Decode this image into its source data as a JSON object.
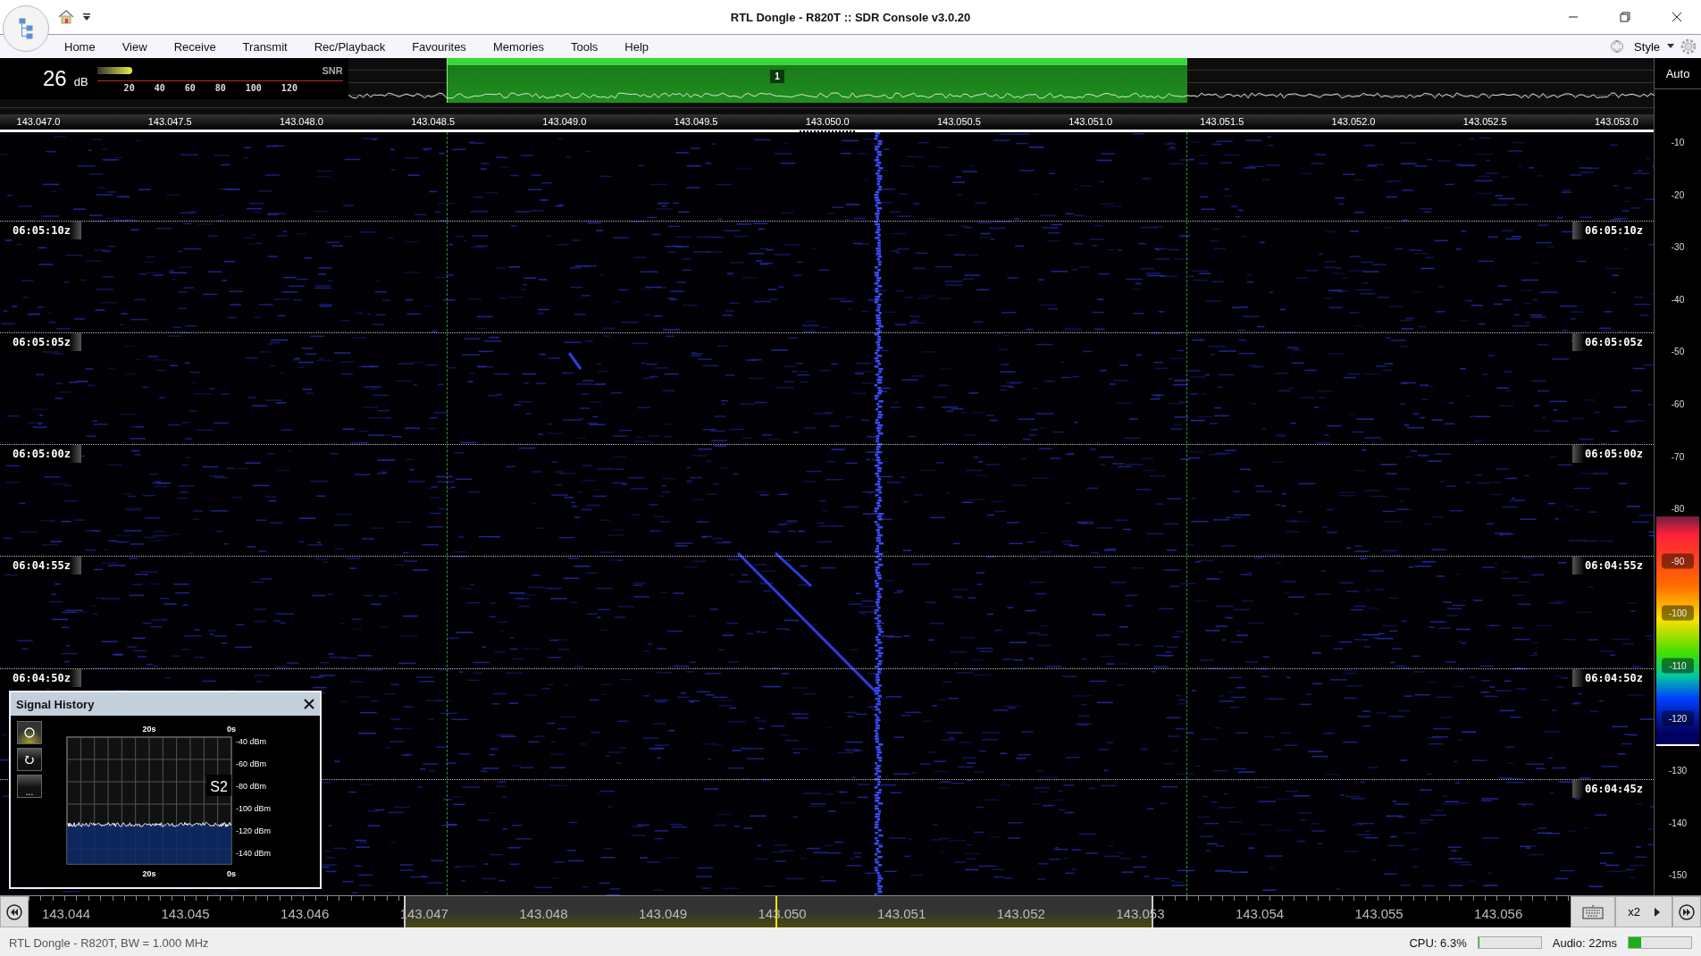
{
  "window": {
    "title": "RTL Dongle - R820T :: SDR Console v3.0.20"
  },
  "menu": [
    "Home",
    "View",
    "Receive",
    "Transmit",
    "Rec/Playback",
    "Favourites",
    "Memories",
    "Tools",
    "Help"
  ],
  "style_menu": {
    "label": "Style"
  },
  "snr_meter": {
    "value": "26",
    "unit": "dB",
    "label": "SNR",
    "level": 0.3,
    "scale": [
      "20",
      "40",
      "60",
      "80",
      "100",
      "120"
    ]
  },
  "spectrum": {
    "receiver_marker": "1",
    "frequency_labels": [
      "143.047.0",
      "143.047.5",
      "143.048.0",
      "143.048.5",
      "143.049.0",
      "143.049.5",
      "143.050.0",
      "143.050.5",
      "143.051.0",
      "143.051.5",
      "143.052.0",
      "143.052.5",
      "143.053.0"
    ]
  },
  "level_scale": {
    "auto_button": "Auto",
    "labels": [
      {
        "text": "-10",
        "kind": "plain"
      },
      {
        "text": "-20",
        "kind": "plain"
      },
      {
        "text": "-30",
        "kind": "plain"
      },
      {
        "text": "-40",
        "kind": "plain"
      },
      {
        "text": "-50",
        "kind": "plain"
      },
      {
        "text": "-60",
        "kind": "plain"
      },
      {
        "text": "-70",
        "kind": "plain"
      },
      {
        "text": "-80",
        "kind": "plain"
      },
      {
        "text": "-90",
        "kind": "marker"
      },
      {
        "text": "-100",
        "kind": "marker"
      },
      {
        "text": "-110",
        "kind": "marker"
      },
      {
        "text": "-120",
        "kind": "marker"
      },
      {
        "text": "-130",
        "kind": "plain"
      },
      {
        "text": "-140",
        "kind": "plain"
      },
      {
        "text": "-150",
        "kind": "plain"
      }
    ]
  },
  "waterfall": {
    "left_time_labels": [
      "06:05:10z",
      "06:05:05z",
      "06:05:00z",
      "06:04:55z",
      "06:04:50z"
    ],
    "right_time_labels": [
      "06:05:10z",
      "06:05:05z",
      "06:05:00z",
      "06:04:55z",
      "06:04:50z",
      "06:04:45z"
    ]
  },
  "signal_history": {
    "title": "Signal History",
    "more_button": "...",
    "top_time_labels": [
      "20s",
      "0s"
    ],
    "bottom_time_labels": [
      "20s",
      "0s"
    ],
    "level_labels": [
      "-40 dBm",
      "-60 dBm",
      "-80 dBm",
      "-100 dBm",
      "-120 dBm",
      "-140 dBm"
    ],
    "s_meter": "S2"
  },
  "tuning_bar": {
    "frequency_labels": [
      "143.044",
      "143.045",
      "143.046",
      "143.047",
      "143.048",
      "143.049",
      "143.050",
      "143.051",
      "143.052",
      "143.053",
      "143.054",
      "143.055",
      "143.056"
    ],
    "zoom": "x2"
  },
  "status_bar": {
    "text": "RTL Dongle - R820T, BW = 1.000 MHz",
    "cpu": {
      "label": "CPU: 6.3%",
      "level": 0.02
    },
    "audio": {
      "label": "Audio: 22ms",
      "level": 0.2
    }
  }
}
